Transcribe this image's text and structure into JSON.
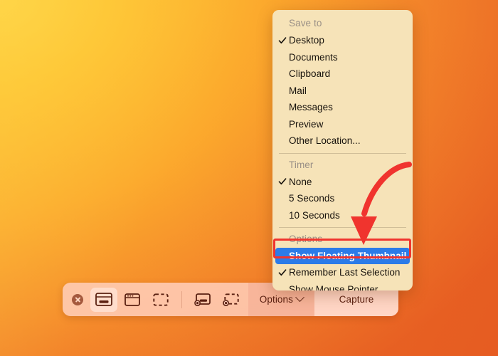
{
  "desktop": {
    "wallpaper_gradient_from": "#FFD447",
    "wallpaper_gradient_to": "#E65C22"
  },
  "toolbar": {
    "name": "screenshot-toolbar",
    "close_label": "Close",
    "buttons": [
      {
        "id": "capture-entire-screen",
        "label": "Capture Entire Screen",
        "icon": "screen-icon",
        "selected": true
      },
      {
        "id": "capture-selected-window",
        "label": "Capture Selected Window",
        "icon": "window-icon",
        "selected": false
      },
      {
        "id": "capture-selected-portion",
        "label": "Capture Selected Portion",
        "icon": "dashed-rect-icon",
        "selected": false
      },
      {
        "id": "record-entire-screen",
        "label": "Record Entire Screen",
        "icon": "record-screen-icon",
        "selected": false
      },
      {
        "id": "record-selected-portion",
        "label": "Record Selected Portion",
        "icon": "record-portion-icon",
        "selected": false
      }
    ],
    "options_label": "Options",
    "capture_label": "Capture"
  },
  "menu": {
    "sections": [
      {
        "header": "Save to",
        "items": [
          {
            "label": "Desktop",
            "checked": true
          },
          {
            "label": "Documents",
            "checked": false
          },
          {
            "label": "Clipboard",
            "checked": false
          },
          {
            "label": "Mail",
            "checked": false
          },
          {
            "label": "Messages",
            "checked": false
          },
          {
            "label": "Preview",
            "checked": false
          },
          {
            "label": "Other Location...",
            "checked": false
          }
        ]
      },
      {
        "header": "Timer",
        "items": [
          {
            "label": "None",
            "checked": true
          },
          {
            "label": "5 Seconds",
            "checked": false
          },
          {
            "label": "10 Seconds",
            "checked": false
          }
        ]
      },
      {
        "header": "Options",
        "items": [
          {
            "label": "Show Floating Thumbnail",
            "checked": false,
            "highlighted": true
          },
          {
            "label": "Remember Last Selection",
            "checked": true
          },
          {
            "label": "Show Mouse Pointer",
            "checked": false
          }
        ]
      }
    ]
  },
  "annotations": {
    "highlight_color": "#F0342E",
    "arrow_color": "#F0342E",
    "arrow_target": "Show Floating Thumbnail",
    "selection_color": "#2C7BE8"
  }
}
